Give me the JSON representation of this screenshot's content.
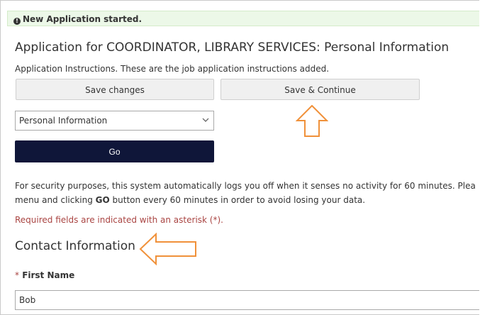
{
  "alert": {
    "icon": "info-icon",
    "glyph": "!",
    "text": "New Application started."
  },
  "header": {
    "title": "Application for COORDINATOR, LIBRARY SERVICES: Personal Information",
    "instructions": "Application Instructions. These are the job application instructions added."
  },
  "actions": {
    "save_label": "Save changes",
    "continue_label": "Save & Continue"
  },
  "section_select": {
    "selected": "Personal Information",
    "icon": "chevron-down-icon"
  },
  "go": {
    "label": "Go"
  },
  "security": {
    "part1": "For security purposes, this system automatically logs you off when it senses no activity for 60 minutes. Plea",
    "part2_pre": "menu and clicking ",
    "part2_bold": "GO",
    "part2_post": " button every 60 minutes in order to avoid losing your data."
  },
  "required_note": "Required fields are indicated with an asterisk (*).",
  "contact": {
    "title": "Contact Information",
    "first_name": {
      "asterisk": "*",
      "label": "First Name",
      "value": "Bob"
    }
  },
  "annotations": {
    "arrow_color": "#f0913a",
    "up_arrow": "arrow-up-icon",
    "left_arrow": "arrow-left-icon"
  }
}
